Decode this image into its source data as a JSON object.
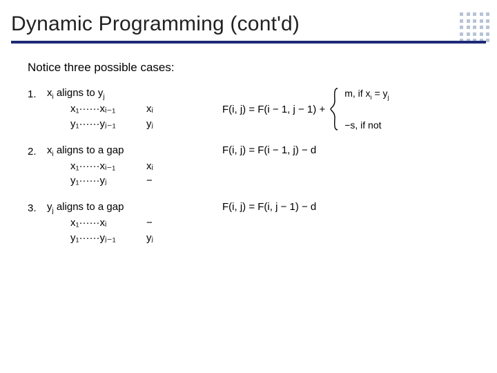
{
  "title": "Dynamic Programming (cont'd)",
  "intro": "Notice three possible cases:",
  "cases": {
    "one": {
      "num": "1.",
      "head_pre": "x",
      "head_sub1": "i",
      "head_mid": " aligns to y",
      "head_sub2": "j",
      "row1_left": "x₁······xᵢ₋₁",
      "row1_right": "xᵢ",
      "row2_left": "y₁······yⱼ₋₁",
      "row2_right": "yⱼ",
      "formula": "F(i, j) = F(i − 1, j − 1) +",
      "branch_top_pre": "m, if x",
      "branch_top_sub1": "i",
      "branch_top_mid": " = y",
      "branch_top_sub2": "j",
      "branch_bot": "−s, if not"
    },
    "two": {
      "num": "2.",
      "head_pre": "x",
      "head_sub1": "i",
      "head_mid": " aligns to a gap",
      "row1_left": "x₁······xᵢ₋₁",
      "row1_right": "xᵢ",
      "row2_left": "y₁······yⱼ",
      "row2_right": "−",
      "formula": "F(i, j) = F(i − 1, j) − d"
    },
    "three": {
      "num": "3.",
      "head_pre": "y",
      "head_sub1": "j",
      "head_mid": " aligns to a gap",
      "row1_left": "x₁······xᵢ",
      "row1_right": "−",
      "row2_left": "y₁······yⱼ₋₁",
      "row2_right": "yⱼ",
      "formula": "F(i, j) = F(i, j − 1) − d"
    }
  }
}
